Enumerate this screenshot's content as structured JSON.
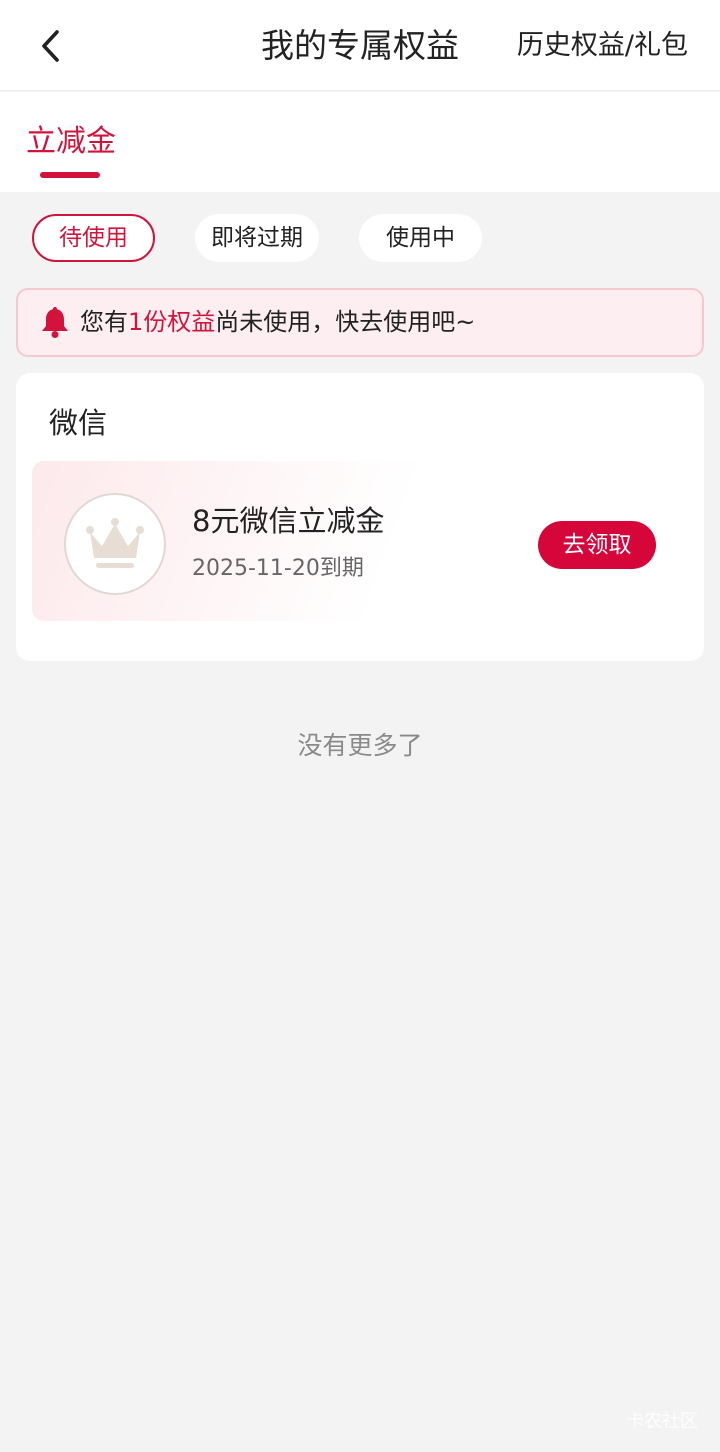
{
  "header": {
    "title": "我的专属权益",
    "history_link": "历史权益/礼包",
    "back_icon": "chevron-left-icon"
  },
  "tabs": [
    {
      "label": "立减金",
      "active": true
    }
  ],
  "filters": [
    {
      "label": "待使用",
      "active": true
    },
    {
      "label": "即将过期",
      "active": false
    },
    {
      "label": "使用中",
      "active": false
    }
  ],
  "notice": {
    "icon": "bell-icon",
    "prefix": "您有",
    "highlight": "1份权益",
    "suffix": "尚未使用，快去使用吧~"
  },
  "section": {
    "heading": "微信",
    "coupon": {
      "icon": "crown-icon",
      "title": "8元微信立减金",
      "expiry": "2025-11-20到期",
      "action": "去领取"
    }
  },
  "footer": {
    "no_more": "没有更多了"
  },
  "watermark": "卡农社区",
  "colors": {
    "accent": "#d2143c",
    "button": "#d6053a",
    "notice_bg": "#fdeff1",
    "page_bg": "#f3f3f3"
  }
}
